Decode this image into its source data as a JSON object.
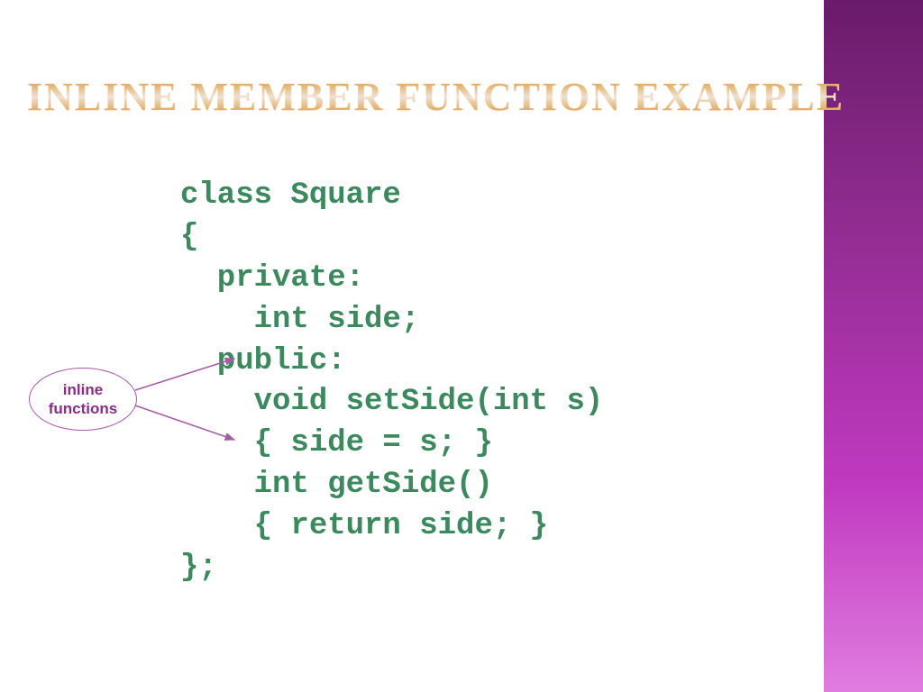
{
  "title": "INLINE MEMBER FUNCTION EXAMPLE",
  "code": "class Square\n{\n  private:\n    int side;\n  public:\n    void setSide(int s)\n    { side = s; }\n    int getSide()\n    { return side; }\n};",
  "callout": {
    "line1": "inline",
    "line2": "functions"
  },
  "colors": {
    "code": "#3b8a5e",
    "callout_border": "#a75aa7",
    "callout_text": "#8a2c8a",
    "gradient_top": "#6a1b6a",
    "gradient_bottom": "#e07de0"
  }
}
